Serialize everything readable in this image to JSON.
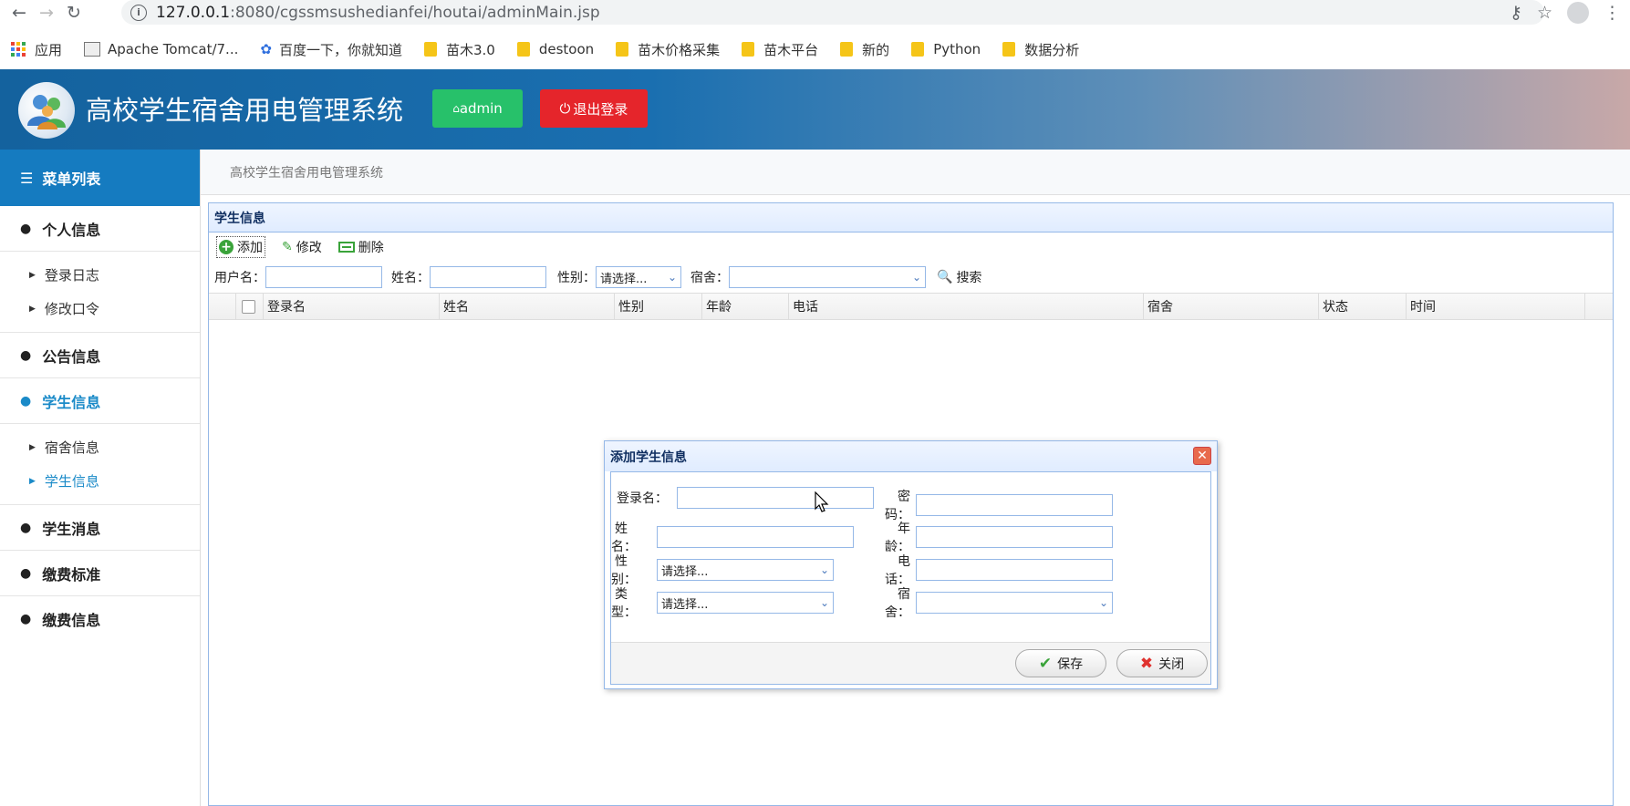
{
  "browser": {
    "url_host": "127.0.0.1",
    "url_path": ":8080/cgssmsushedianfei/houtai/adminMain.jsp",
    "bookmarks": [
      "应用",
      "Apache Tomcat/7...",
      "百度一下，你就知道",
      "苗木3.0",
      "destoon",
      "苗木价格采集",
      "苗木平台",
      "新的",
      "Python",
      "数据分析"
    ]
  },
  "header": {
    "title": "高校学生宿舍用电管理系统",
    "admin_label": "admin",
    "logout_label": "退出登录"
  },
  "sidebar": {
    "menu_title": "菜单列表",
    "sections": {
      "personal": "个人信息",
      "login_log": "登录日志",
      "change_password": "修改口令",
      "notice": "公告信息",
      "student": "学生信息",
      "dorm_info": "宿舍信息",
      "student_info": "学生信息",
      "messages": "学生消息",
      "fee_standard": "缴费标准",
      "fee_info": "缴费信息"
    }
  },
  "breadcrumb": "高校学生宿舍用电管理系统",
  "panel": {
    "title": "学生信息",
    "toolbar": {
      "add": "添加",
      "edit": "修改",
      "delete": "删除"
    },
    "search": {
      "username_label": "用户名：",
      "name_label": "姓名：",
      "gender_label": "性别：",
      "gender_value": "请选择...",
      "dorm_label": "宿舍：",
      "search_label": "搜索"
    },
    "columns": [
      "登录名",
      "姓名",
      "性别",
      "年龄",
      "电话",
      "宿舍",
      "状态",
      "时间"
    ]
  },
  "dialog": {
    "title": "添加学生信息",
    "fields": {
      "login_name": "登录名：",
      "password": "密码：",
      "name": "姓名：",
      "age": "年龄：",
      "gender": "性别：",
      "gender_value": "请选择...",
      "phone": "电话：",
      "type": "类型：",
      "type_value": "请选择...",
      "dorm": "宿舍："
    },
    "save": "保存",
    "close": "关闭"
  },
  "colors": {
    "accent": "#157bc0",
    "admin_btn": "#27c16a",
    "logout_btn": "#e5252b",
    "active_menu": "#1a8ac8",
    "panel_border": "#95b8e7"
  }
}
